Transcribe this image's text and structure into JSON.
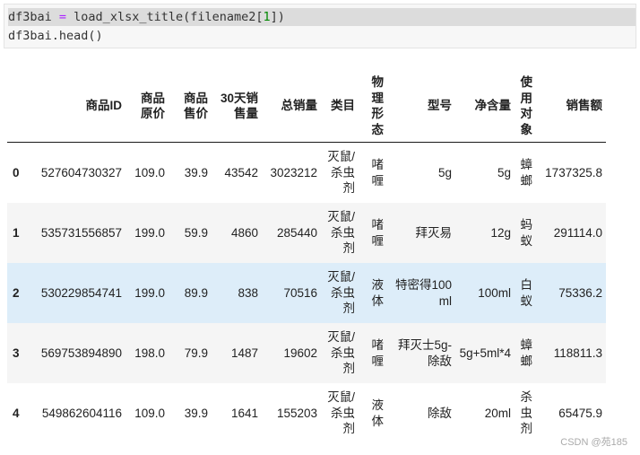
{
  "code": {
    "line1_func_part": "df3bai ",
    "line1_eq": "=",
    "line1_call": " load_xlsx_title(filename2[",
    "line1_idx": "1",
    "line1_close": "])",
    "line2": "df3bai.head()"
  },
  "table": {
    "headers": [
      "",
      "商品ID",
      "商品原价",
      "商品售价",
      "30天销售量",
      "总销量",
      "类目",
      "物理形态",
      "型号",
      "净含量",
      "使用对象",
      "销售额"
    ],
    "rows": [
      [
        "0",
        "527604730327",
        "109.0",
        "39.9",
        "43542",
        "3023212",
        "灭鼠/杀虫剂",
        "啫喱",
        "5g",
        "5g",
        "蟑螂",
        "1737325.8"
      ],
      [
        "1",
        "535731556857",
        "199.0",
        "59.9",
        "4860",
        "285440",
        "灭鼠/杀虫剂",
        "啫喱",
        "拜灭易",
        "12g",
        "蚂蚁",
        "291114.0"
      ],
      [
        "2",
        "530229854741",
        "199.0",
        "89.9",
        "838",
        "70516",
        "灭鼠/杀虫剂",
        "液体",
        "特密得100ml",
        "100ml",
        "白蚁",
        "75336.2"
      ],
      [
        "3",
        "569753894890",
        "198.0",
        "79.9",
        "1487",
        "19602",
        "灭鼠/杀虫剂",
        "啫喱",
        "拜灭士5g-除敌",
        "5g+5ml*4",
        "蟑螂",
        "118811.3"
      ],
      [
        "4",
        "549862604116",
        "109.0",
        "39.9",
        "1641",
        "155203",
        "灭鼠/杀虫剂",
        "液体",
        "除敌",
        "20ml",
        "杀虫剂",
        "65475.9"
      ]
    ]
  },
  "watermark": "CSDN @苑185"
}
